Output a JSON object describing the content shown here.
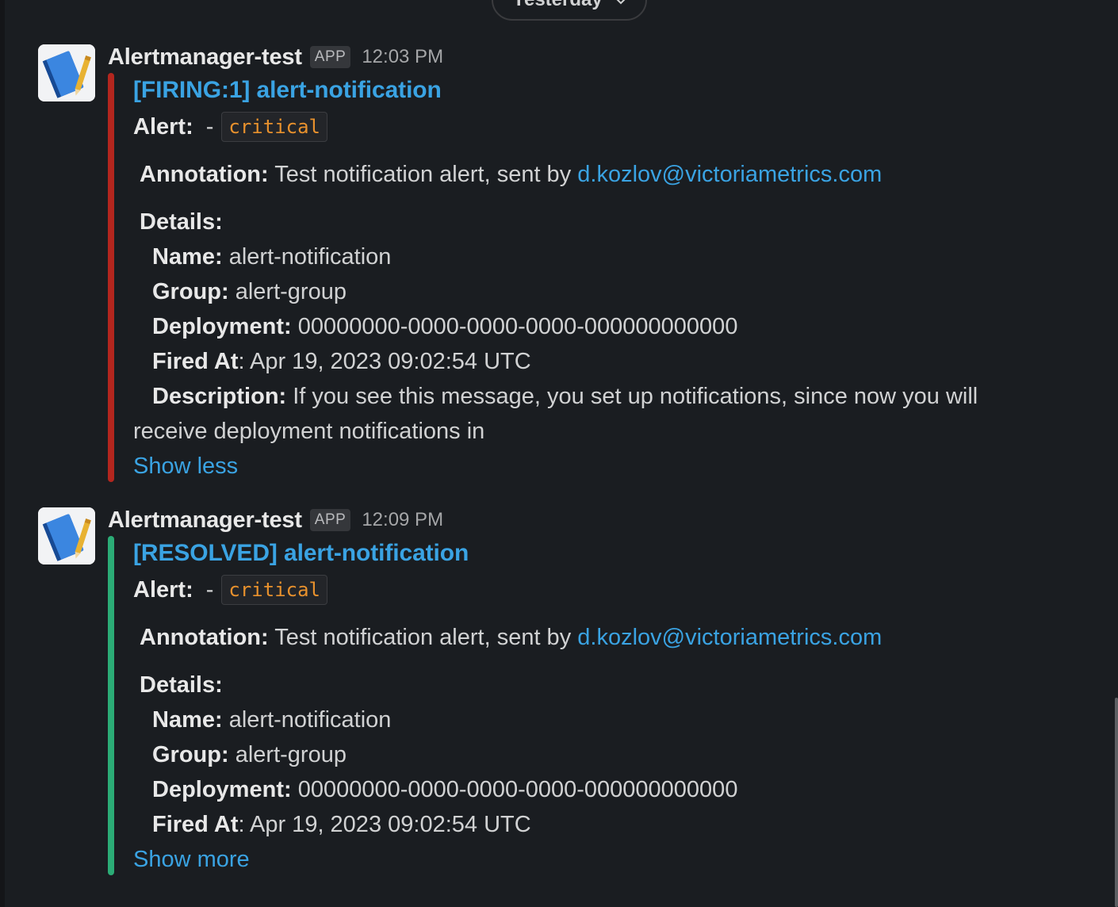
{
  "day_divider": {
    "label": "Yesterday",
    "chevron": "chevron-down-icon"
  },
  "messages": [
    {
      "sender": "Alertmanager-test",
      "badge": "APP",
      "time": "12:03 PM",
      "avatar_icon": "notebook-icon",
      "bar_color": "#b3261e",
      "title": "[FIRING:1] alert-notification",
      "alert_label": "Alert:",
      "alert_dash": "-",
      "severity": "critical",
      "annotation_label": "Annotation:",
      "annotation_text": "Test notification alert, sent by",
      "annotation_link": "d.kozlov@victoriametrics.com",
      "details_label": "Details:",
      "details": {
        "name_label": "Name:",
        "name": "alert-notification",
        "group_label": "Group:",
        "group": "alert-group",
        "deployment_label": "Deployment:",
        "deployment": "00000000-0000-0000-0000-000000000000",
        "fired_label": "Fired At",
        "fired": ": Apr 19, 2023 09:02:54 UTC",
        "description_label": "Description:",
        "description_1": "If you see this message, you set up notifications, since now you will",
        "description_2": "receive deployment notifications in"
      },
      "toggle": "Show less"
    },
    {
      "sender": "Alertmanager-test",
      "badge": "APP",
      "time": "12:09 PM",
      "avatar_icon": "notebook-icon",
      "bar_color": "#2bac76",
      "title": "[RESOLVED] alert-notification",
      "alert_label": "Alert:",
      "alert_dash": "-",
      "severity": "critical",
      "annotation_label": "Annotation:",
      "annotation_text": "Test notification alert, sent by",
      "annotation_link": "d.kozlov@victoriametrics.com",
      "details_label": "Details:",
      "details": {
        "name_label": "Name:",
        "name": "alert-notification",
        "group_label": "Group:",
        "group": "alert-group",
        "deployment_label": "Deployment:",
        "deployment": "00000000-0000-0000-0000-000000000000",
        "fired_label": "Fired At",
        "fired": ": Apr 19, 2023 09:02:54 UTC"
      },
      "toggle": "Show more"
    }
  ]
}
